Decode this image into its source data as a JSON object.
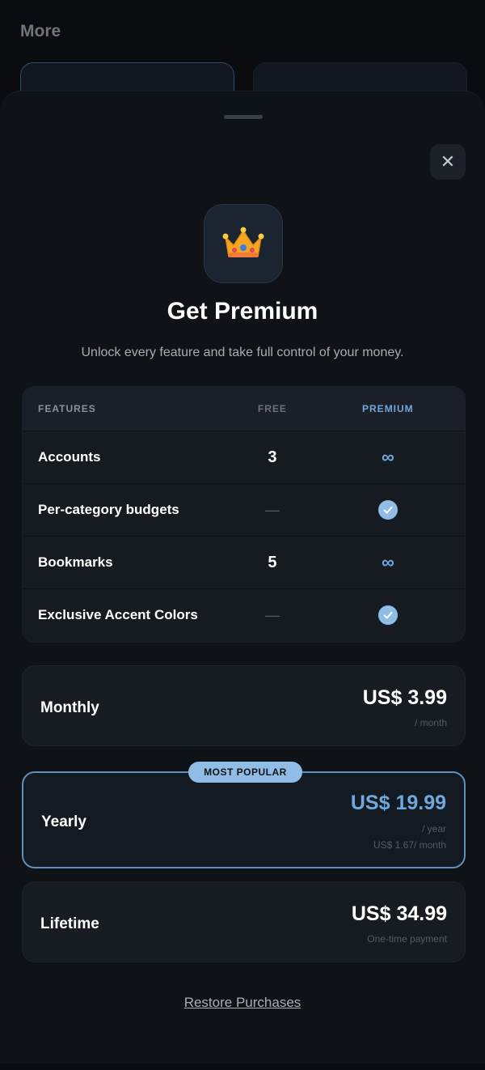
{
  "background": {
    "title": "More"
  },
  "sheet": {
    "close_icon": "close-icon",
    "crown_icon": "crown-icon",
    "title": "Get Premium",
    "subtitle": "Unlock every feature and take full control of your money."
  },
  "features_table": {
    "headers": {
      "features": "FEATURES",
      "free": "FREE",
      "premium": "PREMIUM"
    },
    "rows": [
      {
        "feature": "Accounts",
        "free": "3",
        "premium": "∞"
      },
      {
        "feature": "Per-category budgets",
        "free": "—",
        "premium": "check"
      },
      {
        "feature": "Bookmarks",
        "free": "5",
        "premium": "∞"
      },
      {
        "feature": "Exclusive Accent Colors",
        "free": "—",
        "premium": "check"
      }
    ]
  },
  "plans": {
    "monthly": {
      "name": "Monthly",
      "price": "US$ 3.99",
      "period": "/ month"
    },
    "yearly": {
      "badge": "MOST POPULAR",
      "name": "Yearly",
      "price": "US$ 19.99",
      "period": "/ year",
      "per_month": "US$ 1.67/ month"
    },
    "lifetime": {
      "name": "Lifetime",
      "price": "US$ 34.99",
      "period": "One-time payment"
    }
  },
  "restore_label": "Restore Purchases",
  "colors": {
    "accent": "#6fa8dc",
    "accent_light": "#8fbde6",
    "sheet_bg": "#0f1217"
  }
}
